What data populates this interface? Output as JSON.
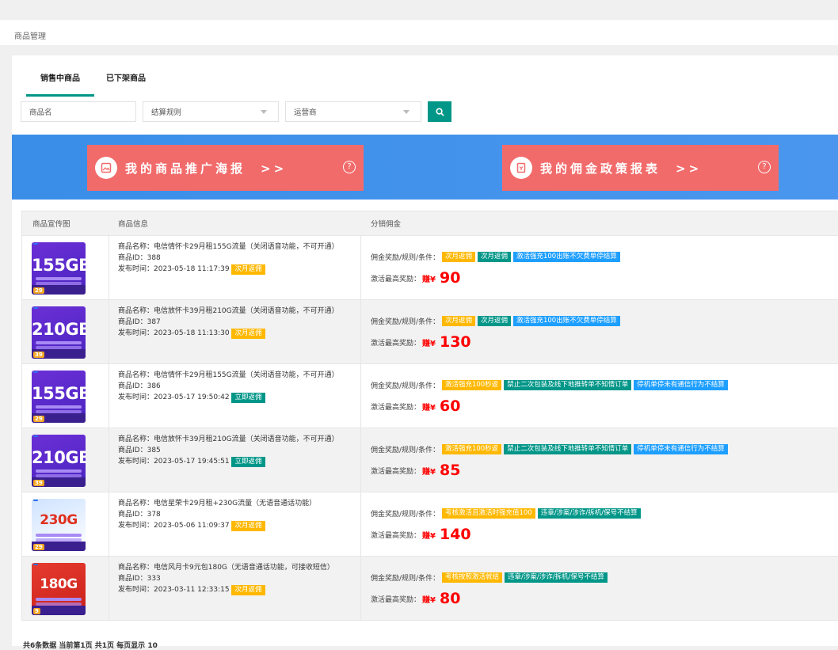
{
  "breadcrumb": "商品管理",
  "tabs": [
    {
      "label": "销售中商品"
    },
    {
      "label": "已下架商品"
    }
  ],
  "filters": {
    "name_placeholder": "商品名",
    "rule_placeholder": "结算规则",
    "carrier_placeholder": "运营商"
  },
  "banners": [
    {
      "label": "我的商品推广海报　>>"
    },
    {
      "label": "我的佣金政策报表　>>"
    }
  ],
  "table": {
    "headers": [
      "商品宣传图",
      "商品信息",
      "分销佣金"
    ]
  },
  "labels": {
    "name": "商品名称：",
    "id": "商品ID：",
    "time": "发布时间：",
    "rule": "佣金奖励/规则/条件：",
    "max": "激活最高奖励：",
    "earn": "赚¥"
  },
  "products": [
    {
      "name": "电信情怀卡29月租155G流量（关闭语音功能，不可开通）",
      "id": "388",
      "time": "2023-05-18 11:17:39",
      "settle": "次月返佣",
      "tags": [
        "次月返佣",
        "次月返佣",
        "激活强充100出账不欠费单停结算"
      ],
      "reward": "90",
      "thumb": "155GB",
      "price": "29"
    },
    {
      "name": "电信放怀卡39月租210G流量（关闭语音功能，不可开通）",
      "id": "387",
      "time": "2023-05-18 11:13:30",
      "settle": "次月返佣",
      "tags": [
        "次月返佣",
        "次月返佣",
        "激活强充100出账不欠费单停结算"
      ],
      "reward": "130",
      "thumb": "210GB",
      "price": "39"
    },
    {
      "name": "电信情怀卡29月租155G流量（关闭语音功能，不可开通）",
      "id": "386",
      "time": "2023-05-17 19:50:42",
      "settle": "立即返佣",
      "tags": [
        "激活强充100秒返",
        "禁止二次包装及线下地推转单不知情订单",
        "停机单停未有通信行为不结算"
      ],
      "reward": "60",
      "thumb": "155GB",
      "price": "29"
    },
    {
      "name": "电信放怀卡39月租210G流量（关闭语音功能，不可开通）",
      "id": "385",
      "time": "2023-05-17 19:45:51",
      "settle": "立即返佣",
      "tags": [
        "激活强充100秒返",
        "禁止二次包装及线下地推转单不知情订单",
        "停机单停未有通信行为不结算"
      ],
      "reward": "85",
      "thumb": "210GB",
      "price": "39"
    },
    {
      "name": "电信星荣卡29月租+230G流量（无语音通话功能）",
      "id": "378",
      "time": "2023-05-06 11:09:37",
      "settle": "次月返佣",
      "tags": [
        "考核激活且激活时强充值100",
        "违章/涉案/涉诈/拆机/保号不结算"
      ],
      "reward": "140",
      "thumb": "230G",
      "price": "29"
    },
    {
      "name": "电信风月卡9元包180G（无语音通话功能，可接收短信）",
      "id": "333",
      "time": "2023-03-11 12:33:15",
      "settle": "次月返佣",
      "tags": [
        "考核按照激活就结",
        "违章/涉案/涉诈/拆机/保号不结算"
      ],
      "reward": "80",
      "thumb": "180G",
      "price": "9"
    }
  ],
  "pager": "共6条数据 当前第1页 共1页 每页显示 10"
}
